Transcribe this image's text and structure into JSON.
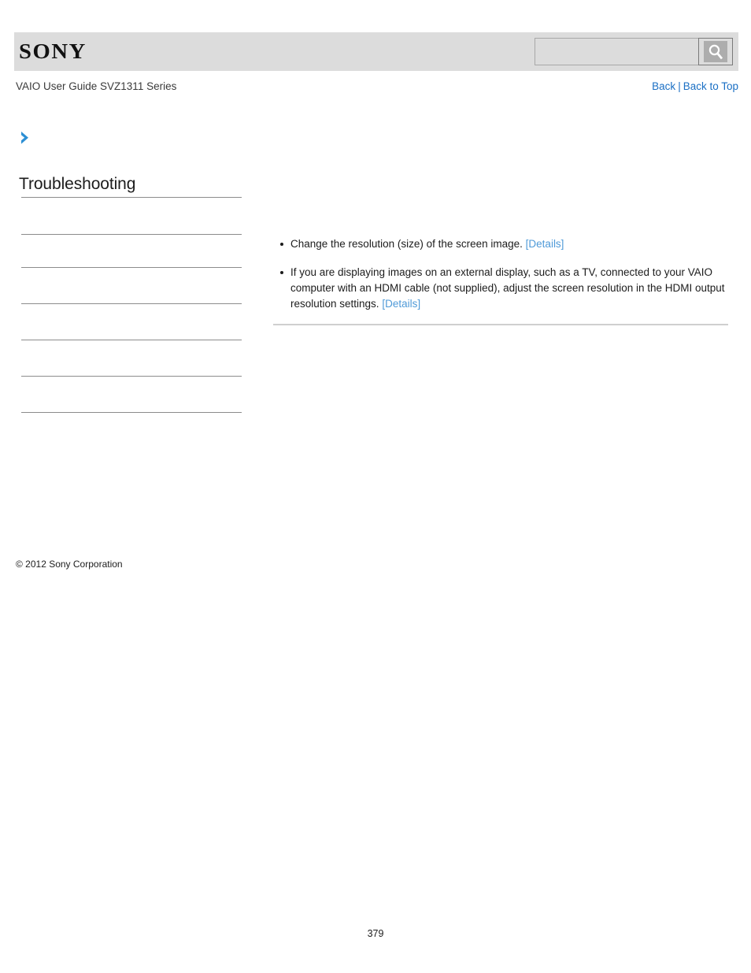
{
  "header": {
    "logo_text": "SONY",
    "logo_name": "sony-logo",
    "background_color": "#dcdcdc"
  },
  "search": {
    "value": "",
    "placeholder": "",
    "icon": "search-icon",
    "button_label": ""
  },
  "subheader": {
    "guide_title": "VAIO User Guide SVZ1311 Series",
    "nav": {
      "back_label": "Back",
      "separator": "|",
      "back_to_top_label": "Back to Top",
      "link_color": "#1a6fc4"
    }
  },
  "sidebar": {
    "breadcrumb_icon": "chevron-right-icon",
    "breadcrumb_icon_color": "#2c8fd4",
    "heading": "Troubleshooting",
    "items": [
      {
        "label": ""
      },
      {
        "label": ""
      },
      {
        "label": ""
      },
      {
        "label": ""
      },
      {
        "label": ""
      },
      {
        "label": ""
      }
    ],
    "copyright": "© 2012 Sony Corporation"
  },
  "content": {
    "bullets": [
      {
        "text": "Change the resolution (size) of the screen image. ",
        "link": "[Details]",
        "text_after": ""
      },
      {
        "text": "If you are displaying images on an external display, such as a TV, connected to your VAIO computer with an HDMI cable (not supplied), adjust the screen resolution in the HDMI output resolution settings. ",
        "link": "[Details]",
        "text_after": ""
      }
    ],
    "link_color": "#4f9ad8"
  },
  "footer": {
    "page_number": "379"
  }
}
